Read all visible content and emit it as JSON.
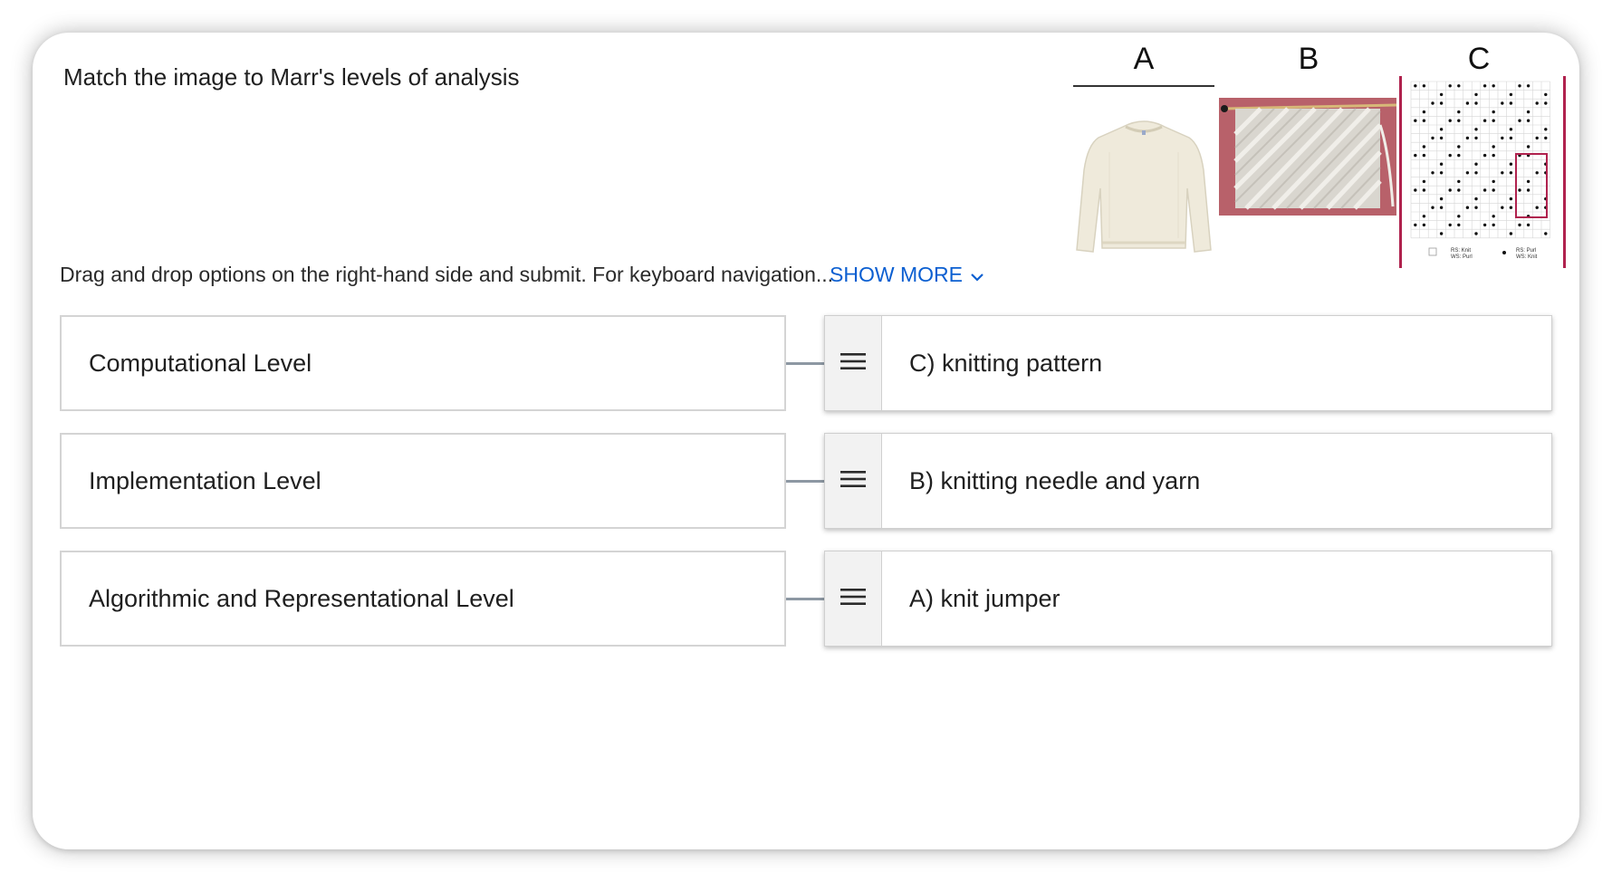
{
  "question": {
    "title": "Match the image to Marr's levels of analysis",
    "image_labels": [
      "A",
      "B",
      "C"
    ],
    "chart_legend": {
      "open_square_line1": "RS: Knit",
      "open_square_line2": "WS: Purl",
      "dot_line1": "RS: Purl",
      "dot_line2": "WS: Knit"
    }
  },
  "instructions": {
    "text": "Drag and drop options on the right-hand side and submit. For keyboard navigation...",
    "show_more_label": "SHOW MORE"
  },
  "matches": [
    {
      "prompt": "Computational Level",
      "answer": "C) knitting pattern"
    },
    {
      "prompt": "Implementation Level",
      "answer": "B) knitting needle and yarn"
    },
    {
      "prompt": "Algorithmic and Representational Level",
      "answer": "A) knit jumper"
    }
  ],
  "colors": {
    "link": "#0b5fd1",
    "connector": "#8d98a3",
    "swatch_background": "#b8616a",
    "chart_highlight": "#b0224e"
  },
  "icons": {
    "drag_handle": "hamburger-drag-icon",
    "show_more": "chevron-down-icon"
  }
}
